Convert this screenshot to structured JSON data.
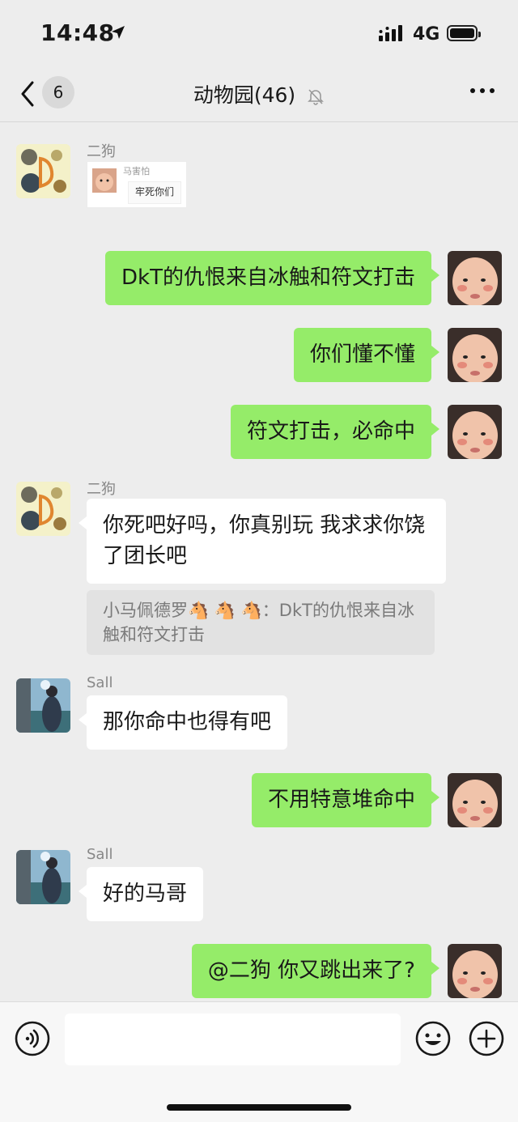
{
  "status": {
    "time": "14:48",
    "network": "4G"
  },
  "nav": {
    "badge": "6",
    "title": "动物园(46)"
  },
  "messages": [
    {
      "sender": "二狗",
      "sticker_name": "马害怕",
      "sticker_text": "牢死你们"
    },
    {
      "text": "DkT的仇恨来自冰触和符文打击"
    },
    {
      "text": "你们懂不懂"
    },
    {
      "text": "符文打击，必命中"
    },
    {
      "sender": "二狗",
      "text": "你死吧好吗，你真别玩 我求求你饶了团长吧",
      "quote": "小马佩德罗🐴 🐴 🐴：DkT的仇恨来自冰触和符文打击"
    },
    {
      "sender": "Sall",
      "text": "那你命中也得有吧"
    },
    {
      "text": "不用特意堆命中"
    },
    {
      "sender": "Sall",
      "text": "好的马哥"
    },
    {
      "text": "@二狗 你又跳出来了?"
    }
  ],
  "input": {
    "value": ""
  },
  "colors": {
    "background": "#ededed",
    "outgoing_bubble": "#95ec69",
    "incoming_bubble": "#ffffff"
  }
}
